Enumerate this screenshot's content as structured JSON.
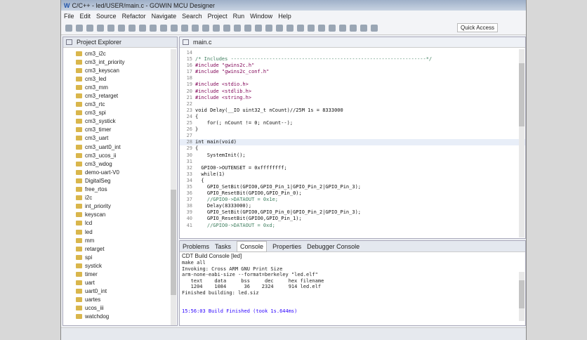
{
  "window": {
    "title": "C/C++ - led/USER/main.c - GOWIN MCU Designer",
    "logo": "W"
  },
  "menu": [
    "File",
    "Edit",
    "Source",
    "Refactor",
    "Navigate",
    "Search",
    "Project",
    "Run",
    "Window",
    "Help"
  ],
  "toolbar": {
    "quick_access": "Quick Access"
  },
  "project_explorer": {
    "title": "Project Explorer",
    "items": [
      "cm3_i2c",
      "cm3_int_priority",
      "cm3_keyscan",
      "cm3_led",
      "cm3_mm",
      "cm3_retarget",
      "cm3_rtc",
      "cm3_spi",
      "cm3_systick",
      "cm3_timer",
      "cm3_uart",
      "cm3_uart0_int",
      "cm3_ucos_ii",
      "cm3_wdog",
      "demo-uart-V0",
      "DigitalSeg",
      "free_rtos",
      "i2c",
      "int_priority",
      "keyscan",
      "lcd",
      "led",
      "mm",
      "retarget",
      "spi",
      "systick",
      "timer",
      "uart",
      "uart0_int",
      "uartes",
      "ucos_iii",
      "watchdog"
    ]
  },
  "editor": {
    "tab": "main.c",
    "lines": [
      {
        "n": "14",
        "t": ""
      },
      {
        "n": "15",
        "t": "/* Includes ------------------------------------------------------------------*/",
        "c": "cm"
      },
      {
        "n": "16",
        "t": "#include \"gwins2c.h\"",
        "c": "inc"
      },
      {
        "n": "17",
        "t": "#include \"gwins2c_conf.h\"",
        "c": "inc"
      },
      {
        "n": "18",
        "t": ""
      },
      {
        "n": "19",
        "t": "#include <stdio.h>",
        "c": "inc"
      },
      {
        "n": "20",
        "t": "#include <stdlib.h>",
        "c": "inc"
      },
      {
        "n": "21",
        "t": "#include <string.h>",
        "c": "inc"
      },
      {
        "n": "22",
        "t": ""
      },
      {
        "n": "23",
        "t": "void Delay(__IO uint32_t nCount)//25M 1s = 8333000"
      },
      {
        "n": "24",
        "t": "{"
      },
      {
        "n": "25",
        "t": "    for(; nCount != 0; nCount--);"
      },
      {
        "n": "26",
        "t": "}"
      },
      {
        "n": "27",
        "t": ""
      },
      {
        "n": "28",
        "t": "int main(void)",
        "hl": true
      },
      {
        "n": "29",
        "t": "{"
      },
      {
        "n": "30",
        "t": "    SystemInit();"
      },
      {
        "n": "31",
        "t": ""
      },
      {
        "n": "32",
        "t": "  GPIO0->OUTENSET = 0xffffffff;"
      },
      {
        "n": "33",
        "t": "  while(1)"
      },
      {
        "n": "34",
        "t": "  {"
      },
      {
        "n": "35",
        "t": "    GPIO_SetBit(GPIO0,GPIO_Pin_1|GPIO_Pin_2|GPIO_Pin_3);"
      },
      {
        "n": "36",
        "t": "    GPIO_ResetBit(GPIO0,GPIO_Pin_0);"
      },
      {
        "n": "37",
        "t": "    //GPIO0->DATAOUT = 0x1e;",
        "c": "cm"
      },
      {
        "n": "38",
        "t": "    Delay(8333000);"
      },
      {
        "n": "39",
        "t": "    GPIO_SetBit(GPIO0,GPIO_Pin_0|GPIO_Pin_2|GPIO_Pin_3);"
      },
      {
        "n": "40",
        "t": "    GPIO_ResetBit(GPIO0,GPIO_Pin_1);"
      },
      {
        "n": "41",
        "t": "    //GPIO0->DATAOUT = 0xd;",
        "c": "cm"
      }
    ]
  },
  "console": {
    "tabs": [
      "Problems",
      "Tasks",
      "Console",
      "Properties",
      "Debugger Console"
    ],
    "header": "CDT Build Console [led]",
    "lines": [
      "make all",
      "Invoking: Cross ARM GNU Print Size",
      "arm-none-eabi-size --format=berkeley \"led.elf\"",
      "   text    data     bss     dec     hex filename",
      "   1204    1084      36    2324     914 led.elf",
      "Finished building: led.siz",
      "",
      ""
    ],
    "finish": "15:56:03 Build Finished (took 1s.644ms)"
  }
}
